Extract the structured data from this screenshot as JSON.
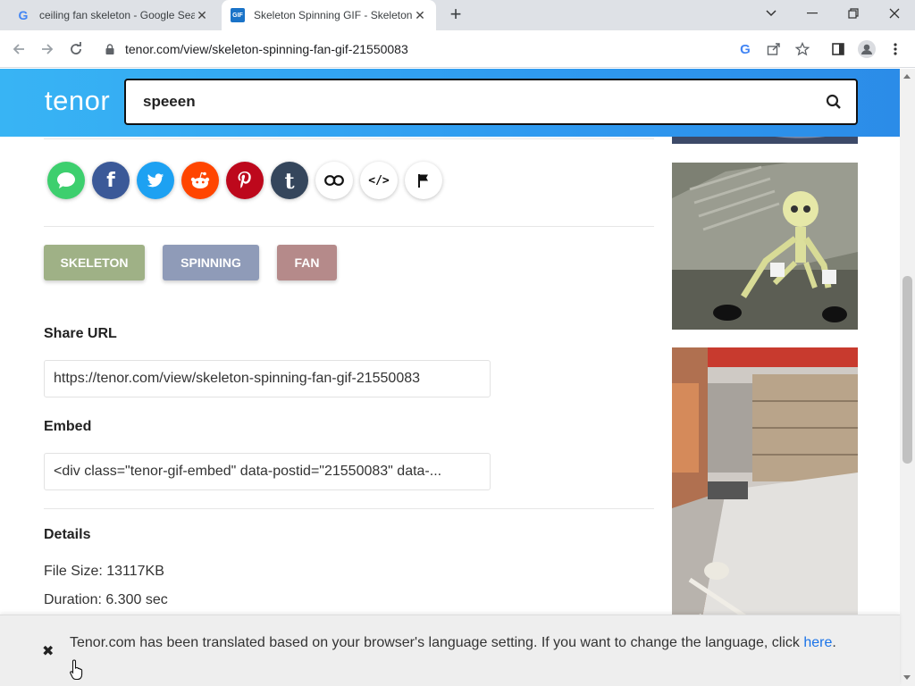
{
  "browser": {
    "tabs": [
      {
        "title": "ceiling fan skeleton - Google Sea",
        "favicon": "google-icon",
        "active": false
      },
      {
        "title": "Skeleton Spinning GIF - Skeleton",
        "favicon": "gif-icon",
        "active": true
      }
    ],
    "url": "tenor.com/view/skeleton-spinning-fan-gif-21550083",
    "gif_badge": "GIF"
  },
  "header": {
    "logo": "tenor",
    "search_value": "speeen"
  },
  "share": {
    "icons": [
      {
        "name": "sms-icon",
        "color": "#3dcf6e"
      },
      {
        "name": "facebook-icon",
        "color": "#3b5998",
        "glyph": "f"
      },
      {
        "name": "twitter-icon",
        "color": "#1da1f2"
      },
      {
        "name": "reddit-icon",
        "color": "#ff4500"
      },
      {
        "name": "pinterest-icon",
        "color": "#bd081c"
      },
      {
        "name": "tumblr-icon",
        "color": "#35465c",
        "glyph": "t"
      },
      {
        "name": "link-icon",
        "color": "#ffffff"
      },
      {
        "name": "embed-code-icon",
        "color": "#ffffff",
        "glyph": "</>"
      },
      {
        "name": "flag-icon",
        "color": "#ffffff"
      }
    ]
  },
  "tags": [
    {
      "label": "SKELETON",
      "color": "#9fb186"
    },
    {
      "label": "SPINNING",
      "color": "#8f9bb8"
    },
    {
      "label": "FAN",
      "color": "#b58a8a"
    }
  ],
  "share_url": {
    "title": "Share URL",
    "value": "https://tenor.com/view/skeleton-spinning-fan-gif-21550083"
  },
  "embed": {
    "title": "Embed",
    "value": "<div class=\"tenor-gif-embed\" data-postid=\"21550083\" data-..."
  },
  "details": {
    "title": "Details",
    "file_size": "File Size: 13117KB",
    "duration": "Duration: 6.300 sec"
  },
  "banner": {
    "close": "✖",
    "message": "Tenor.com has been translated based on your browser's language setting. If you want to change the language, click ",
    "link": "here",
    "suffix": "."
  }
}
